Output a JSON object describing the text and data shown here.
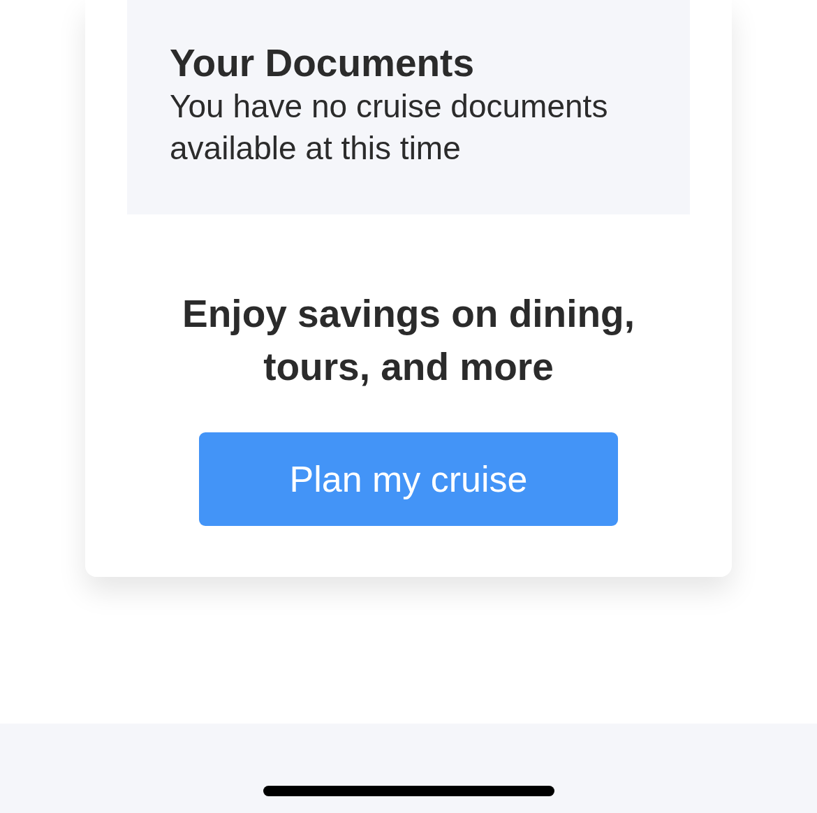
{
  "documents": {
    "title": "Your Documents",
    "message": "You have no cruise documents available at this time"
  },
  "promo": {
    "heading": "Enjoy savings on dining, tours, and more",
    "button": {
      "label": "Plan my cruise"
    }
  }
}
